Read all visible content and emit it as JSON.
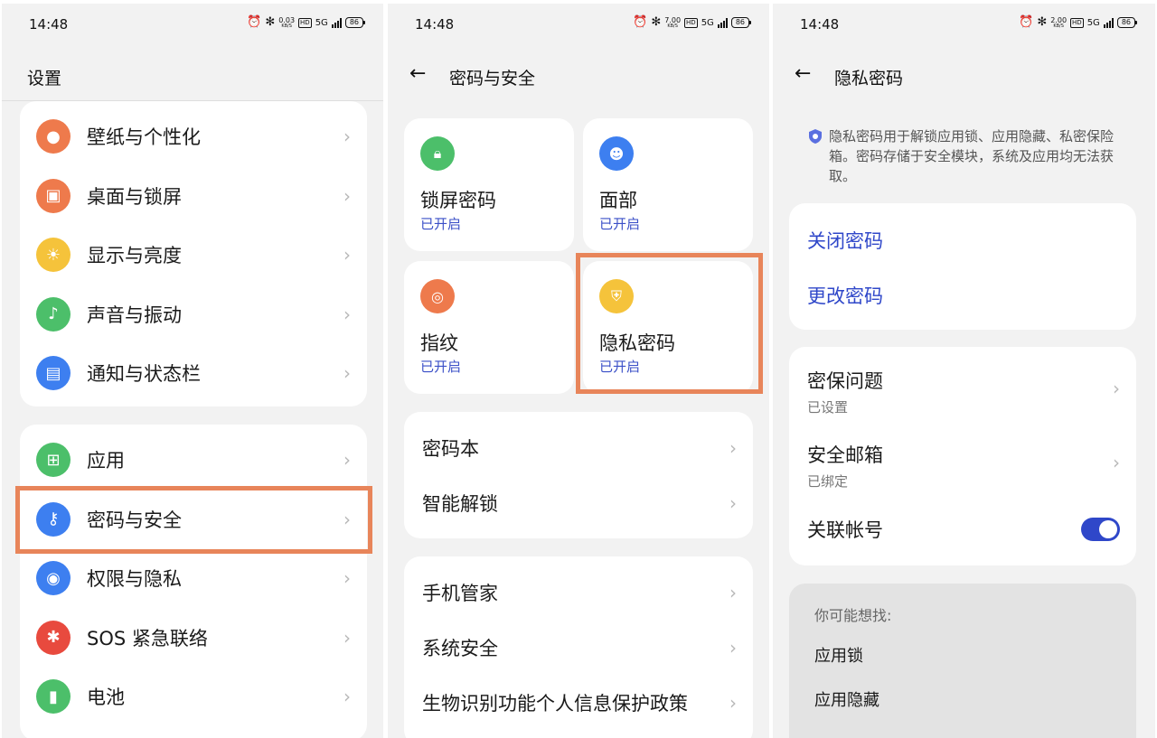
{
  "status": {
    "time": "14:48",
    "speeds": [
      "0.03",
      "7.00",
      "2.00"
    ],
    "speed_unit": "KB/S",
    "hd": "HD",
    "network": "5G",
    "battery": "86"
  },
  "screen1": {
    "title": "设置",
    "group1": [
      {
        "label": "壁纸与个性化",
        "icon": "palette-icon",
        "color": "#ee7a4c"
      },
      {
        "label": "桌面与锁屏",
        "icon": "picture-icon",
        "color": "#ee7a4c"
      },
      {
        "label": "显示与亮度",
        "icon": "sun-icon",
        "color": "#f5c33b"
      },
      {
        "label": "声音与振动",
        "icon": "bell-icon",
        "color": "#4cbf6a"
      },
      {
        "label": "通知与状态栏",
        "icon": "notification-icon",
        "color": "#3d7ff0"
      }
    ],
    "group2": [
      {
        "label": "应用",
        "icon": "apps-grid-icon",
        "color": "#4cbf6a"
      },
      {
        "label": "密码与安全",
        "icon": "key-icon",
        "color": "#3d7ff0"
      },
      {
        "label": "权限与隐私",
        "icon": "eye-lock-icon",
        "color": "#3d7ff0"
      },
      {
        "label": "SOS 紧急联络",
        "icon": "asterisk-icon",
        "color": "#e84a3e"
      },
      {
        "label": "电池",
        "icon": "battery-icon",
        "color": "#4cbf6a"
      }
    ]
  },
  "screen2": {
    "title": "密码与安全",
    "tiles": [
      {
        "name": "锁屏密码",
        "status": "已开启",
        "icon": "lock-icon",
        "color": "#4cbf6a"
      },
      {
        "name": "面部",
        "status": "已开启",
        "icon": "face-icon",
        "color": "#3d7ff0"
      },
      {
        "name": "指纹",
        "status": "已开启",
        "icon": "fingerprint-icon",
        "color": "#ee7a4c"
      },
      {
        "name": "隐私密码",
        "status": "已开启",
        "icon": "shield-key-icon",
        "color": "#f5c33b"
      }
    ],
    "list1": [
      "密码本",
      "智能解锁"
    ],
    "list2": [
      "手机管家",
      "系统安全",
      "生物识别功能个人信息保护政策"
    ]
  },
  "screen3": {
    "title": "隐私密码",
    "info": "隐私密码用于解锁应用锁、应用隐藏、私密保险箱。密码存储于安全模块，系统及应用均无法获取。",
    "actions": [
      "关闭密码",
      "更改密码"
    ],
    "security_question": {
      "label": "密保问题",
      "sub": "已设置"
    },
    "security_email": {
      "label": "安全邮箱",
      "sub": "已绑定"
    },
    "linked_account": {
      "label": "关联帐号",
      "enabled": true
    },
    "suggest_header": "你可能想找:",
    "suggest_items": [
      "应用锁",
      "应用隐藏"
    ]
  },
  "colors": {
    "accent": "#2f47c9",
    "highlight": "#e8855a"
  }
}
